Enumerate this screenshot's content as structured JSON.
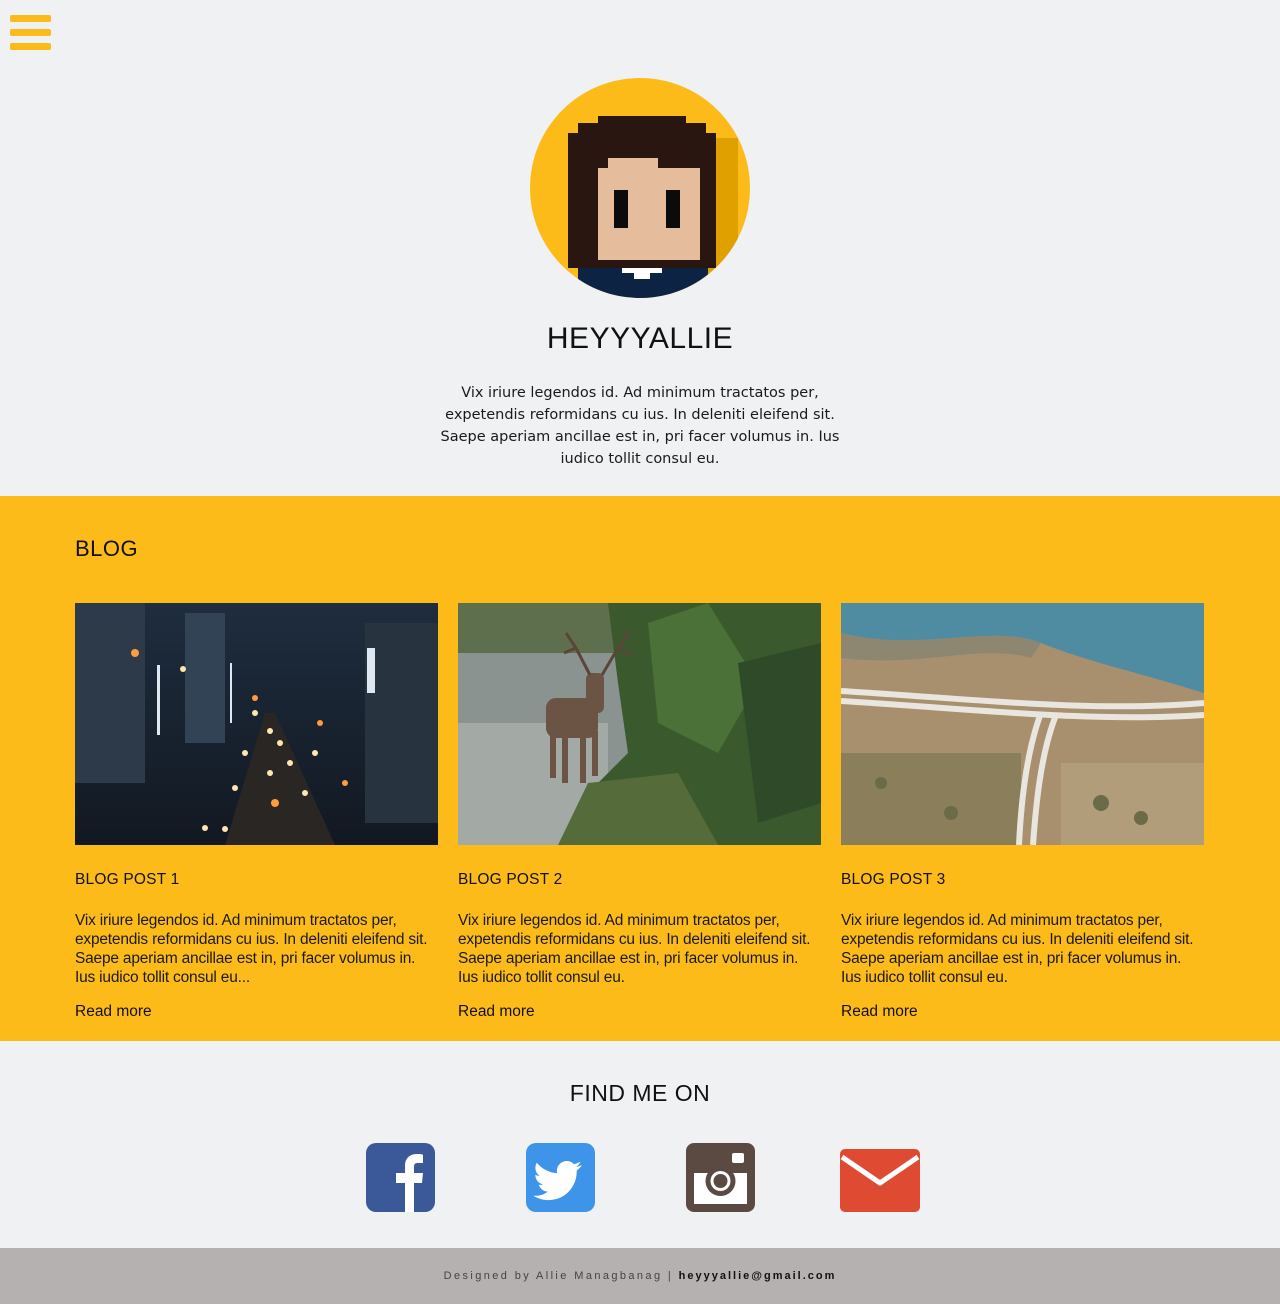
{
  "profile": {
    "name": "HEYYYALLIE",
    "intro": "Vix iriure legendos id. Ad minimum tractatos per, expetendis reformidans cu ius. In deleniti eleifend sit. Saepe aperiam ancillae est in, pri facer volumus in. Ius iudico tollit consul eu."
  },
  "blog": {
    "title": "BLOG",
    "posts": [
      {
        "title": "BLOG POST 1",
        "body": "Vix iriure legendos id. Ad minimum tractatos per, expetendis reformidans cu ius. In deleniti eleifend sit. Saepe aperiam ancillae est in, pri facer volumus in. Ius iudico tollit consul eu...",
        "read_more": "Read more"
      },
      {
        "title": "BLOG POST 2",
        "body": "Vix iriure legendos id. Ad minimum tractatos per, expetendis reformidans cu ius. In deleniti eleifend sit. Saepe aperiam ancillae est in, pri facer volumus in. Ius iudico tollit consul eu.",
        "read_more": "Read more"
      },
      {
        "title": "BLOG POST 3",
        "body": "Vix iriure legendos id. Ad minimum tractatos per, expetendis reformidans cu ius. In deleniti eleifend sit. Saepe aperiam ancillae est in, pri facer volumus in. Ius iudico tollit consul eu.",
        "read_more": "Read more"
      }
    ]
  },
  "find_me": {
    "title": "FIND ME ON",
    "links": [
      {
        "icon": "facebook-icon",
        "color": "#3b5998"
      },
      {
        "icon": "twitter-icon",
        "color": "#3d94e8"
      },
      {
        "icon": "instagram-icon",
        "color": "#5a4a42"
      },
      {
        "icon": "mail-icon",
        "color": "#df4a32"
      }
    ]
  },
  "footer": {
    "credit": "Designed by Allie Managbanag |",
    "email": "heyyyallie@gmail.com"
  },
  "colors": {
    "accent": "#fdbb1a",
    "background": "#f0f1f3",
    "footer": "#b5b1b0"
  }
}
